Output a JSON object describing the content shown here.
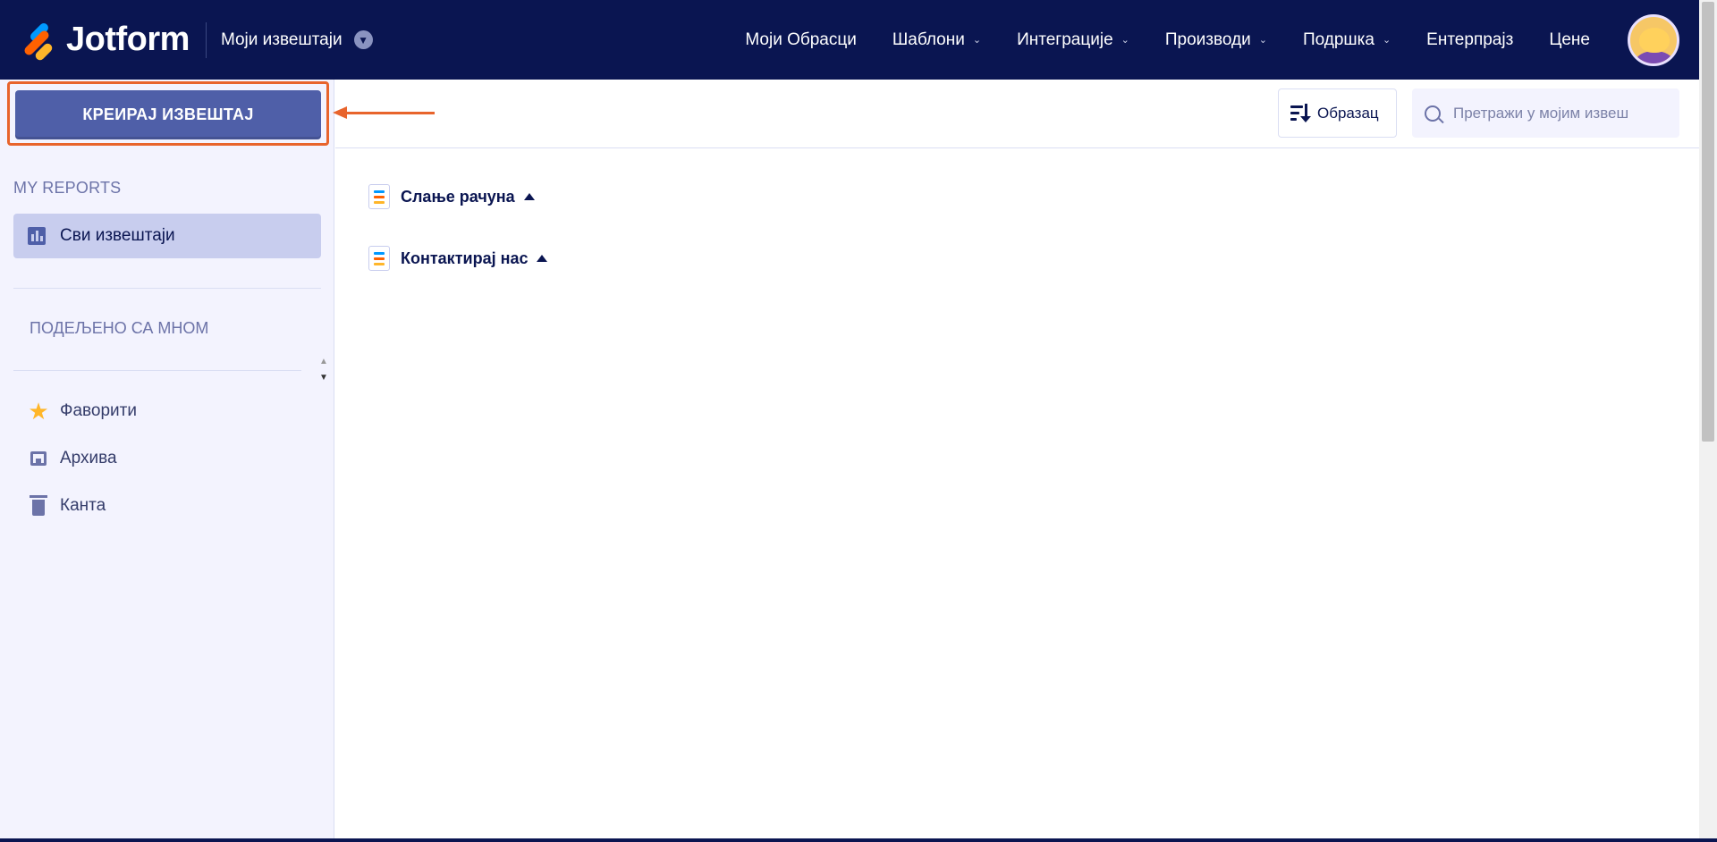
{
  "header": {
    "brand": "Jotform",
    "context_label": "Моји извештаји",
    "nav": [
      {
        "label": "Моји Обрасци",
        "has_dropdown": false
      },
      {
        "label": "Шаблони",
        "has_dropdown": true
      },
      {
        "label": "Интеграције",
        "has_dropdown": true
      },
      {
        "label": "Производи",
        "has_dropdown": true
      },
      {
        "label": "Подршка",
        "has_dropdown": true
      },
      {
        "label": "Ентерпрајз",
        "has_dropdown": false
      },
      {
        "label": "Цене",
        "has_dropdown": false
      }
    ]
  },
  "sidebar": {
    "create_button": "КРЕИРАЈ ИЗВЕШТАЈ",
    "my_reports_heading": "MY REPORTS",
    "all_reports": "Сви извештаји",
    "shared_with_me": "ПОДЕЉЕНО СА МНОМ",
    "links": [
      {
        "label": "Фаворити",
        "icon": "star-icon"
      },
      {
        "label": "Архива",
        "icon": "archive-icon"
      },
      {
        "label": "Канта",
        "icon": "trash-icon"
      }
    ]
  },
  "toolbar": {
    "sort_label": "Образац",
    "search_placeholder": "Претражи у мојим извеш"
  },
  "forms": [
    {
      "title": "Слање рачуна"
    },
    {
      "title": "Контактирај нас"
    }
  ],
  "colors": {
    "navbar": "#0a1551",
    "create_button": "#4f5fa8",
    "highlight": "#e8642c",
    "sidebar_bg": "#f3f3fe",
    "active_item": "#c8cdee"
  }
}
